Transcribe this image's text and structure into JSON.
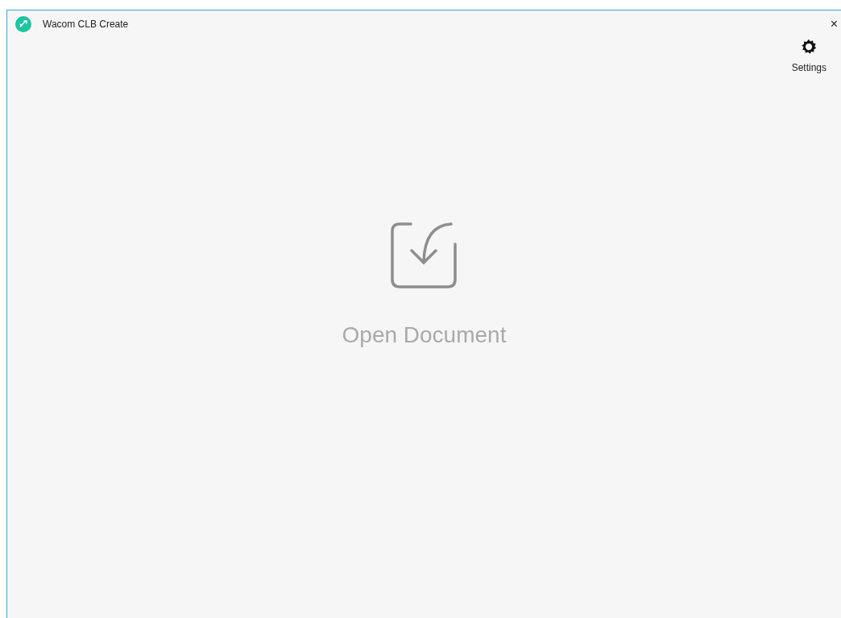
{
  "window": {
    "title": "Wacom CLB Create",
    "close": "×"
  },
  "toolbar": {
    "settings": "Settings"
  },
  "main": {
    "action": "Open Document"
  }
}
